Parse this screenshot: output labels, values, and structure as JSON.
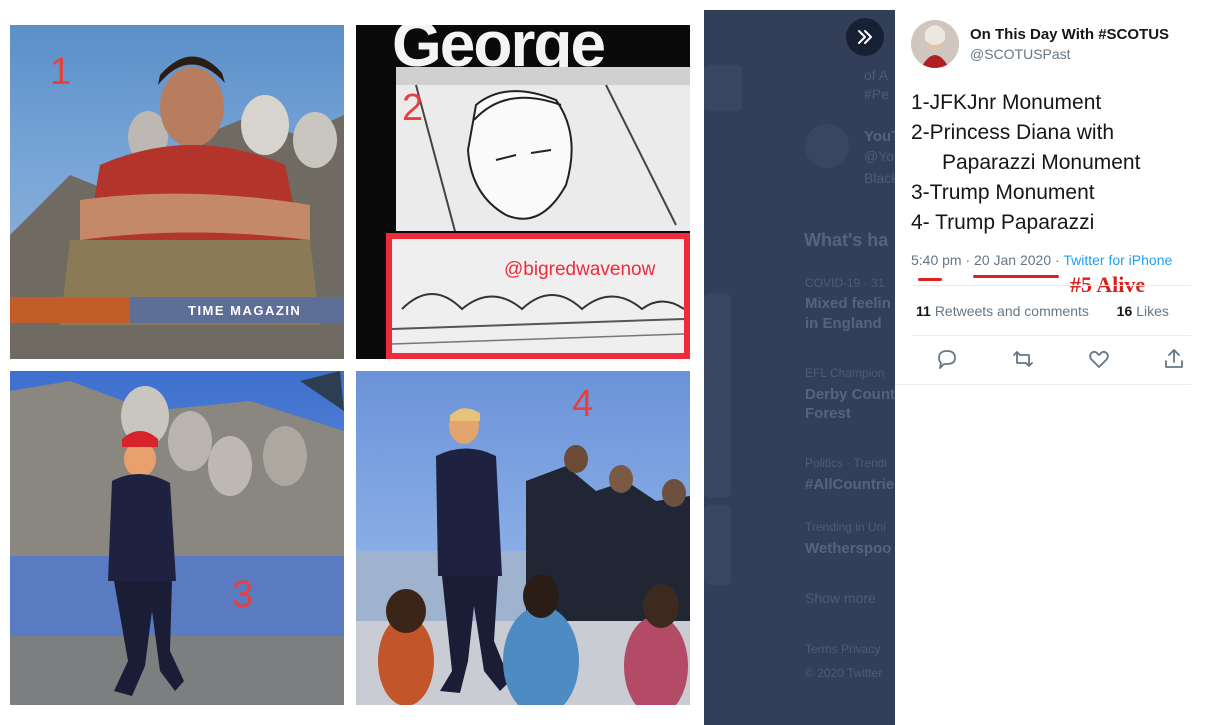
{
  "media": {
    "panel1": {
      "number": "1",
      "caption": "TIME MAGAZIN"
    },
    "panel2": {
      "number": "2",
      "masthead": "George",
      "watermark": "@bigredwavenow"
    },
    "panel3": {
      "number": "3"
    },
    "panel4": {
      "number": "4"
    }
  },
  "background": {
    "ghost_lines": [
      "of A",
      "#Pe",
      "YouT",
      "@Yo",
      "Black",
      "What's ha",
      "COVID-19 · 31",
      "Mixed feelin",
      "in England",
      "EFL Champion",
      "Derby Count",
      "Forest",
      "Politics · Trendi",
      "#AllCountrie",
      "Trending in Uni",
      "Wetherspoo",
      "Show more",
      "Terms  Privacy",
      "© 2020 Twitter"
    ]
  },
  "tweet": {
    "display_name": "On This Day With #SCOTUS",
    "handle": "@SCOTUSPast",
    "lines": [
      "1-JFKJnr Monument",
      "2-Princess Diana with",
      "Paparazzi Monument",
      "3-Trump Monument",
      "4- Trump Paparazzi"
    ],
    "time": "5:40 pm",
    "date": "20 Jan 2020",
    "source": "Twitter for iPhone",
    "sep": "·",
    "annotation": "#5 Alive",
    "retweets_count": "11",
    "retweets_label": "Retweets and comments",
    "likes_count": "16",
    "likes_label": "Likes"
  },
  "icons": {
    "expand": "chevrons-right-icon",
    "reply": "reply-icon",
    "retweet": "retweet-icon",
    "like": "heart-icon",
    "share": "share-icon"
  },
  "colors": {
    "accent": "#1da1f2",
    "annotation_red": "#e0201e",
    "panel_number": "#e8403f",
    "overlay": "#333e58"
  }
}
